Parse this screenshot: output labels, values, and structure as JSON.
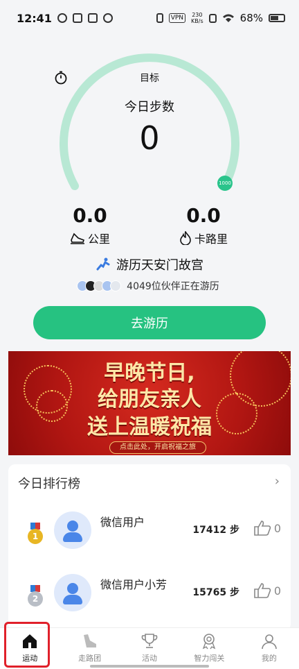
{
  "status": {
    "time": "12:41",
    "vpn": "VPN",
    "speed_value": "230",
    "speed_unit": "KB/s",
    "battery": "68%"
  },
  "gauge": {
    "goal_label": "目标",
    "today_label": "今日步数",
    "steps": "0",
    "goal_value": "1000",
    "accent": "#b8e8d4",
    "dot_color": "#29c48b"
  },
  "stats": {
    "distance_value": "0.0",
    "distance_label": "公里",
    "calorie_value": "0.0",
    "calorie_label": "卡路里"
  },
  "tour": {
    "title": "游历天安门故宫",
    "partners": "4049位伙伴正在游历",
    "button": "去游历"
  },
  "banner": {
    "line1": "早晚节日,",
    "line2": "给朋友亲人",
    "line3": "送上温暖祝福",
    "cta": "点击此处，开启祝福之旅"
  },
  "ranking": {
    "title": "今日排行榜",
    "rows": [
      {
        "medal": "1",
        "name": "微信用户",
        "steps": "17412 步",
        "likes": "0"
      },
      {
        "medal": "2",
        "name": "微信用户小芳",
        "steps": "15765 步",
        "likes": "0"
      }
    ]
  },
  "tabs": [
    {
      "label": "运动",
      "icon": "home-icon",
      "active": true
    },
    {
      "label": "走路团",
      "icon": "shoe-icon",
      "active": false
    },
    {
      "label": "活动",
      "icon": "trophy-icon",
      "active": false
    },
    {
      "label": "智力闯关",
      "icon": "ribbon-badge-icon",
      "active": false
    },
    {
      "label": "我的",
      "icon": "person-icon",
      "active": false
    }
  ]
}
